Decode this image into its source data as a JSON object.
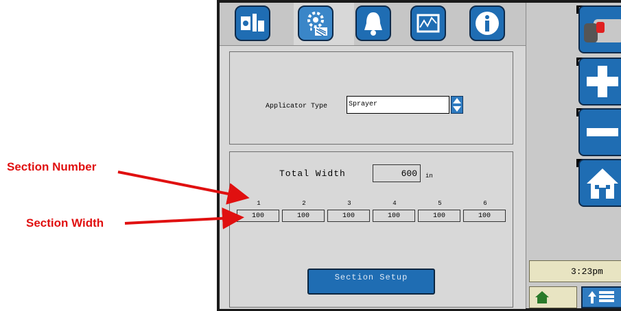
{
  "callouts": {
    "section_number": "Section Number",
    "section_width": "Section Width"
  },
  "tabs": [
    {
      "icon": "implement-setup-icon",
      "active": false
    },
    {
      "icon": "applicator-settings-icon",
      "active": true
    },
    {
      "icon": "alarm-bell-icon",
      "active": false
    },
    {
      "icon": "diagnostics-graph-icon",
      "active": false
    },
    {
      "icon": "info-icon",
      "active": false
    }
  ],
  "applicator": {
    "label": "Applicator Type",
    "value": "Sprayer"
  },
  "total_width": {
    "label": "Total Width",
    "value": "600",
    "unit": "in"
  },
  "sections": [
    {
      "number": "1",
      "width": "100"
    },
    {
      "number": "2",
      "width": "100"
    },
    {
      "number": "3",
      "width": "100"
    },
    {
      "number": "4",
      "width": "100"
    },
    {
      "number": "5",
      "width": "100"
    },
    {
      "number": "6",
      "width": "100"
    }
  ],
  "section_setup_label": "Section Setup",
  "side_keys": [
    "F",
    "G",
    "H",
    "I"
  ],
  "clock": "3:23pm",
  "colors": {
    "button_blue": "#1f6db3",
    "callout_red": "#e01010",
    "status_cream": "#e8e4c2"
  }
}
